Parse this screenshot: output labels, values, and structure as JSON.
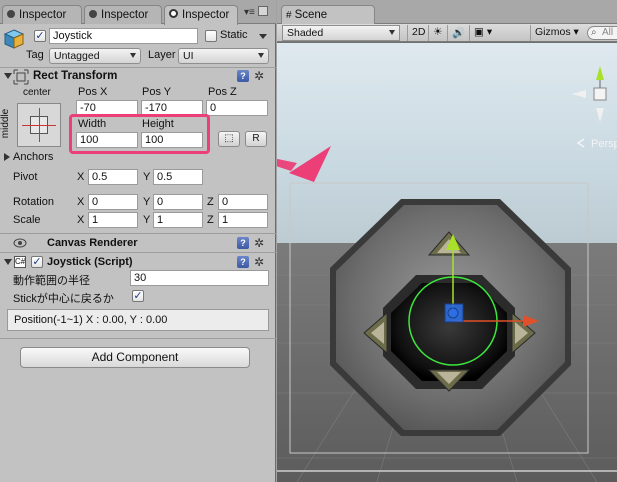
{
  "tabs": [
    {
      "label": "Inspector",
      "icon": "inspector-icon"
    },
    {
      "label": "Inspector",
      "icon": "inspector-icon"
    },
    {
      "label": "Inspector",
      "icon": "inspector-icon",
      "active": true
    }
  ],
  "gameobject": {
    "name": "Joystick",
    "active": true,
    "static_label": "Static",
    "tag_label": "Tag",
    "tag_value": "Untagged",
    "layer_label": "Layer",
    "layer_value": "UI"
  },
  "rect_transform": {
    "title": "Rect Transform",
    "anchor_preset_top": "center",
    "anchor_preset_side": "middle",
    "pos_x_label": "Pos X",
    "pos_x": "-70",
    "pos_y_label": "Pos Y",
    "pos_y": "-170",
    "pos_z_label": "Pos Z",
    "pos_z": "0",
    "width_label": "Width",
    "width": "100",
    "height_label": "Height",
    "height": "100",
    "raw_button": "R",
    "anchors_label": "Anchors",
    "pivot_label": "Pivot",
    "pivot_x": "0.5",
    "pivot_y": "0.5",
    "rotation_label": "Rotation",
    "rot_x": "0",
    "rot_y": "0",
    "rot_z": "0",
    "scale_label": "Scale",
    "scale_x": "1",
    "scale_y": "1",
    "scale_z": "1",
    "x_axis": "X",
    "y_axis": "Y",
    "z_axis": "Z"
  },
  "canvas_renderer": {
    "title": "Canvas Renderer"
  },
  "joystick_script": {
    "title": "Joystick (Script)",
    "enabled": true,
    "radius_label": "動作範囲の半径",
    "radius_value": "30",
    "return_label": "Stickが中心に戻るか",
    "return_value": true,
    "position_readout": "Position(-1~1)   X : 0.00,  Y : 0.00"
  },
  "add_component": "Add Component",
  "scene": {
    "tab_label": "Scene",
    "shading": "Shaded",
    "mode_2d": "2D",
    "gizmos": "Gizmos",
    "search_placeholder": "All",
    "persp_label": "Persp",
    "colors": {
      "sky": "#d7e7ef",
      "ground": "#6c6c6c",
      "grid": "#8a8a8a",
      "highlight_arrow": "#ec3f78",
      "gizmo_y": "#a8e02a",
      "gizmo_x": "#e0502a",
      "gizmo_circle": "#3de63d",
      "handle": "#2d6fe3"
    }
  }
}
